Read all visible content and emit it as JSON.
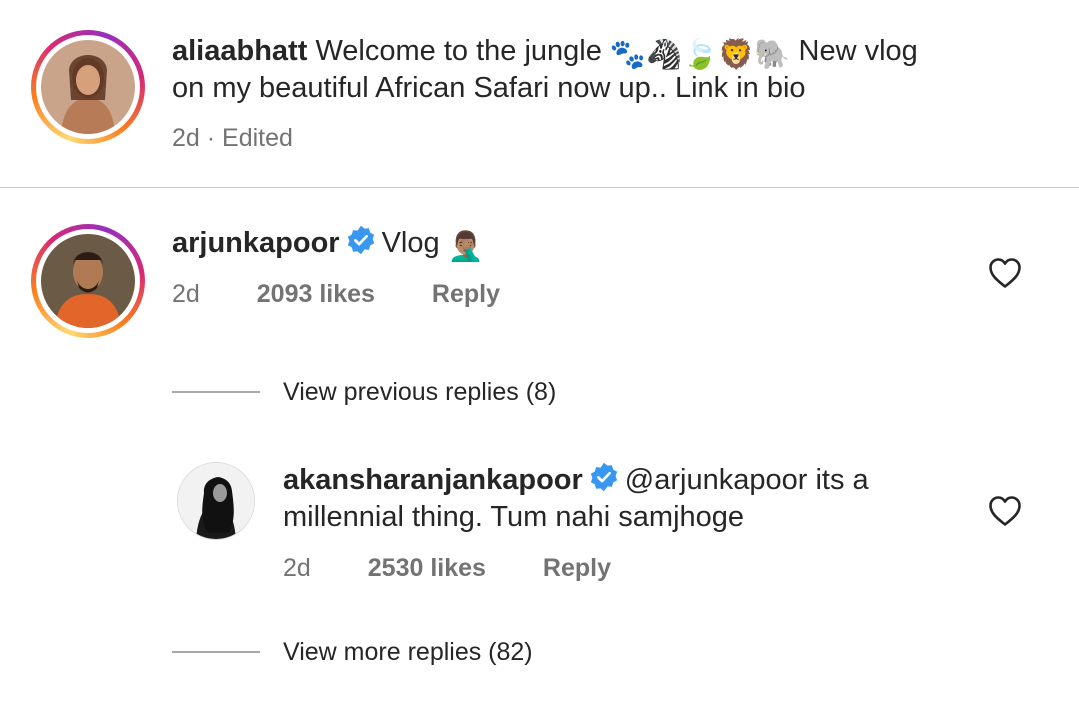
{
  "post": {
    "username": "aliaabhatt",
    "caption_line1": "Welcome to the jungle",
    "caption_emojis": "🐾🦓🍃🦁🐘",
    "caption_line1_end": "New vlog",
    "caption_line2": "on my beautiful African Safari now up.. Link in bio",
    "time": "2d",
    "edited": "· Edited"
  },
  "comment": {
    "username": "arjunkapoor",
    "text": "Vlog",
    "emoji": "🤦🏽‍♂️",
    "time": "2d",
    "likes": "2093 likes",
    "reply_label": "Reply",
    "view_previous": "View previous replies (8)"
  },
  "reply": {
    "username": "akansharanjankapoor",
    "text_line1": "@arjunkapoor its a",
    "text_line2": "millennial thing. Tum nahi samjhoge",
    "time": "2d",
    "likes": "2530 likes",
    "reply_label": "Reply",
    "view_more": "View more replies (82)"
  },
  "colors": {
    "verified": "#3897f0",
    "text": "#262626",
    "secondary": "#737373"
  }
}
